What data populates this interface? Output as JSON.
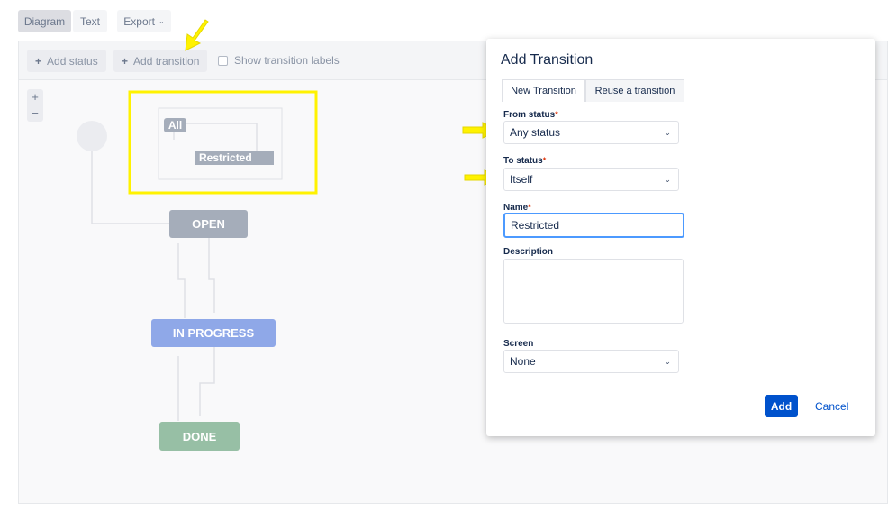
{
  "view_tabs": {
    "diagram": "Diagram",
    "text": "Text",
    "export": "Export"
  },
  "toolbar": {
    "add_status": "Add status",
    "add_transition": "Add transition",
    "show_labels": "Show transition labels"
  },
  "zoom": {
    "in": "+",
    "out": "−"
  },
  "diagram": {
    "all_label": "All",
    "restricted_label": "Restricted",
    "nodes": [
      "OPEN",
      "IN PROGRESS",
      "DONE"
    ]
  },
  "dialog": {
    "title": "Add Transition",
    "tabs": [
      "New Transition",
      "Reuse a transition"
    ],
    "from_label": "From status",
    "from_value": "Any status",
    "to_label": "To status",
    "to_value": "Itself",
    "name_label": "Name",
    "name_value": "Restricted",
    "description_label": "Description",
    "description_value": "",
    "screen_label": "Screen",
    "screen_value": "None",
    "add": "Add",
    "cancel": "Cancel",
    "required_mark": "*"
  },
  "colors": {
    "open": "#a5adba",
    "in_progress": "#8fa8e8",
    "done": "#97bfa5",
    "primary": "#0052cc",
    "highlight": "#fff200"
  }
}
